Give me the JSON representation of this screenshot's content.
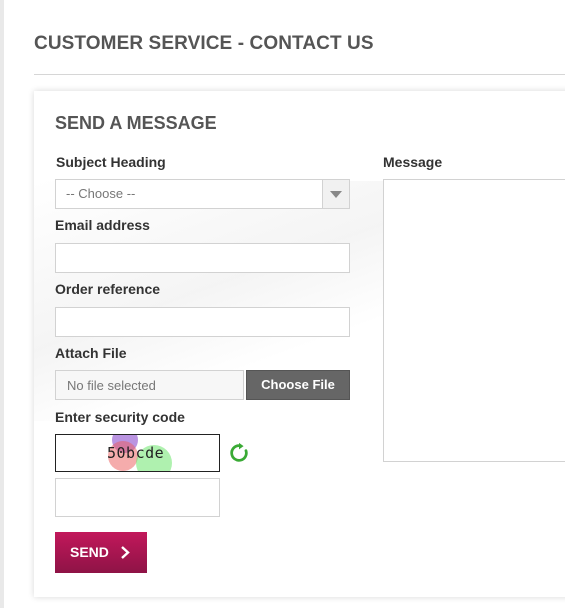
{
  "page": {
    "title": "CUSTOMER SERVICE - CONTACT US"
  },
  "form": {
    "heading": "SEND A MESSAGE",
    "subject_label": "Subject Heading",
    "subject_selected": "-- Choose --",
    "email_label": "Email address",
    "email_value": "",
    "order_label": "Order reference",
    "order_value": "",
    "attach_label": "Attach File",
    "file_status": "No file selected",
    "choose_file_label": "Choose File",
    "security_label": "Enter security code",
    "captcha_text": "50bcde",
    "captcha_value": "",
    "send_label": "SEND",
    "message_label": "Message",
    "message_value": ""
  },
  "icons": {
    "select_arrow": "chevron-down-icon",
    "refresh": "refresh-icon",
    "send": "chevron-right-icon"
  },
  "colors": {
    "send_button": "#b0175a",
    "choose_file_button": "#666666",
    "refresh_icon": "#3aaa35",
    "heading_text": "#555555"
  }
}
